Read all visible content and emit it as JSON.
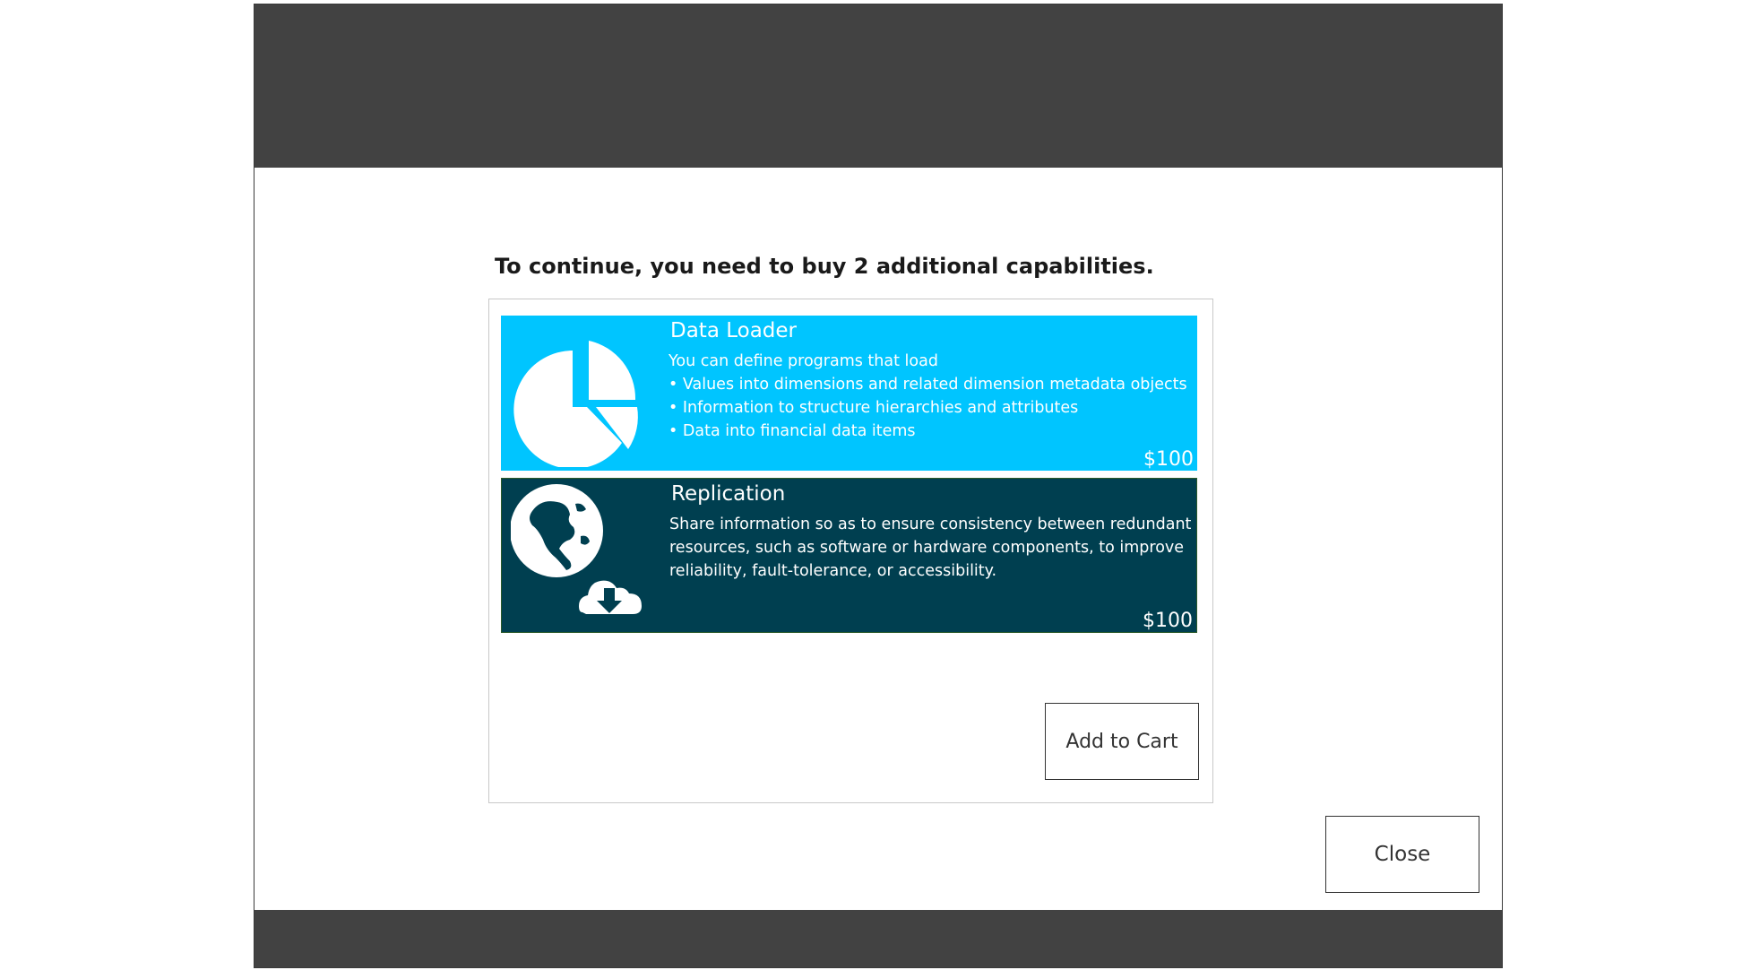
{
  "dialog": {
    "message": "To continue, you need to buy 2 additional capabilities.",
    "add_to_cart_label": "Add to Cart",
    "close_label": "Close"
  },
  "capabilities": [
    {
      "title": "Data Loader",
      "icon": "pie-chart-icon",
      "color": "#00c5ff",
      "description": [
        "You can define programs that load",
        "• Values into dimensions and related dimension metadata objects",
        "• Information to structure hierarchies and attributes",
        "• Data into financial data items"
      ],
      "price": "$100"
    },
    {
      "title": "Replication",
      "icon": "globe-cloud-download-icon",
      "color": "#003f50",
      "description": [
        "Share information so as to ensure consistency between redundant",
        "resources, such as software or hardware components, to improve",
        "reliability, fault-tolerance, or accessibility."
      ],
      "price": "$100"
    }
  ],
  "colors": {
    "band": "#424242",
    "panel_border": "#c8c8c8"
  }
}
